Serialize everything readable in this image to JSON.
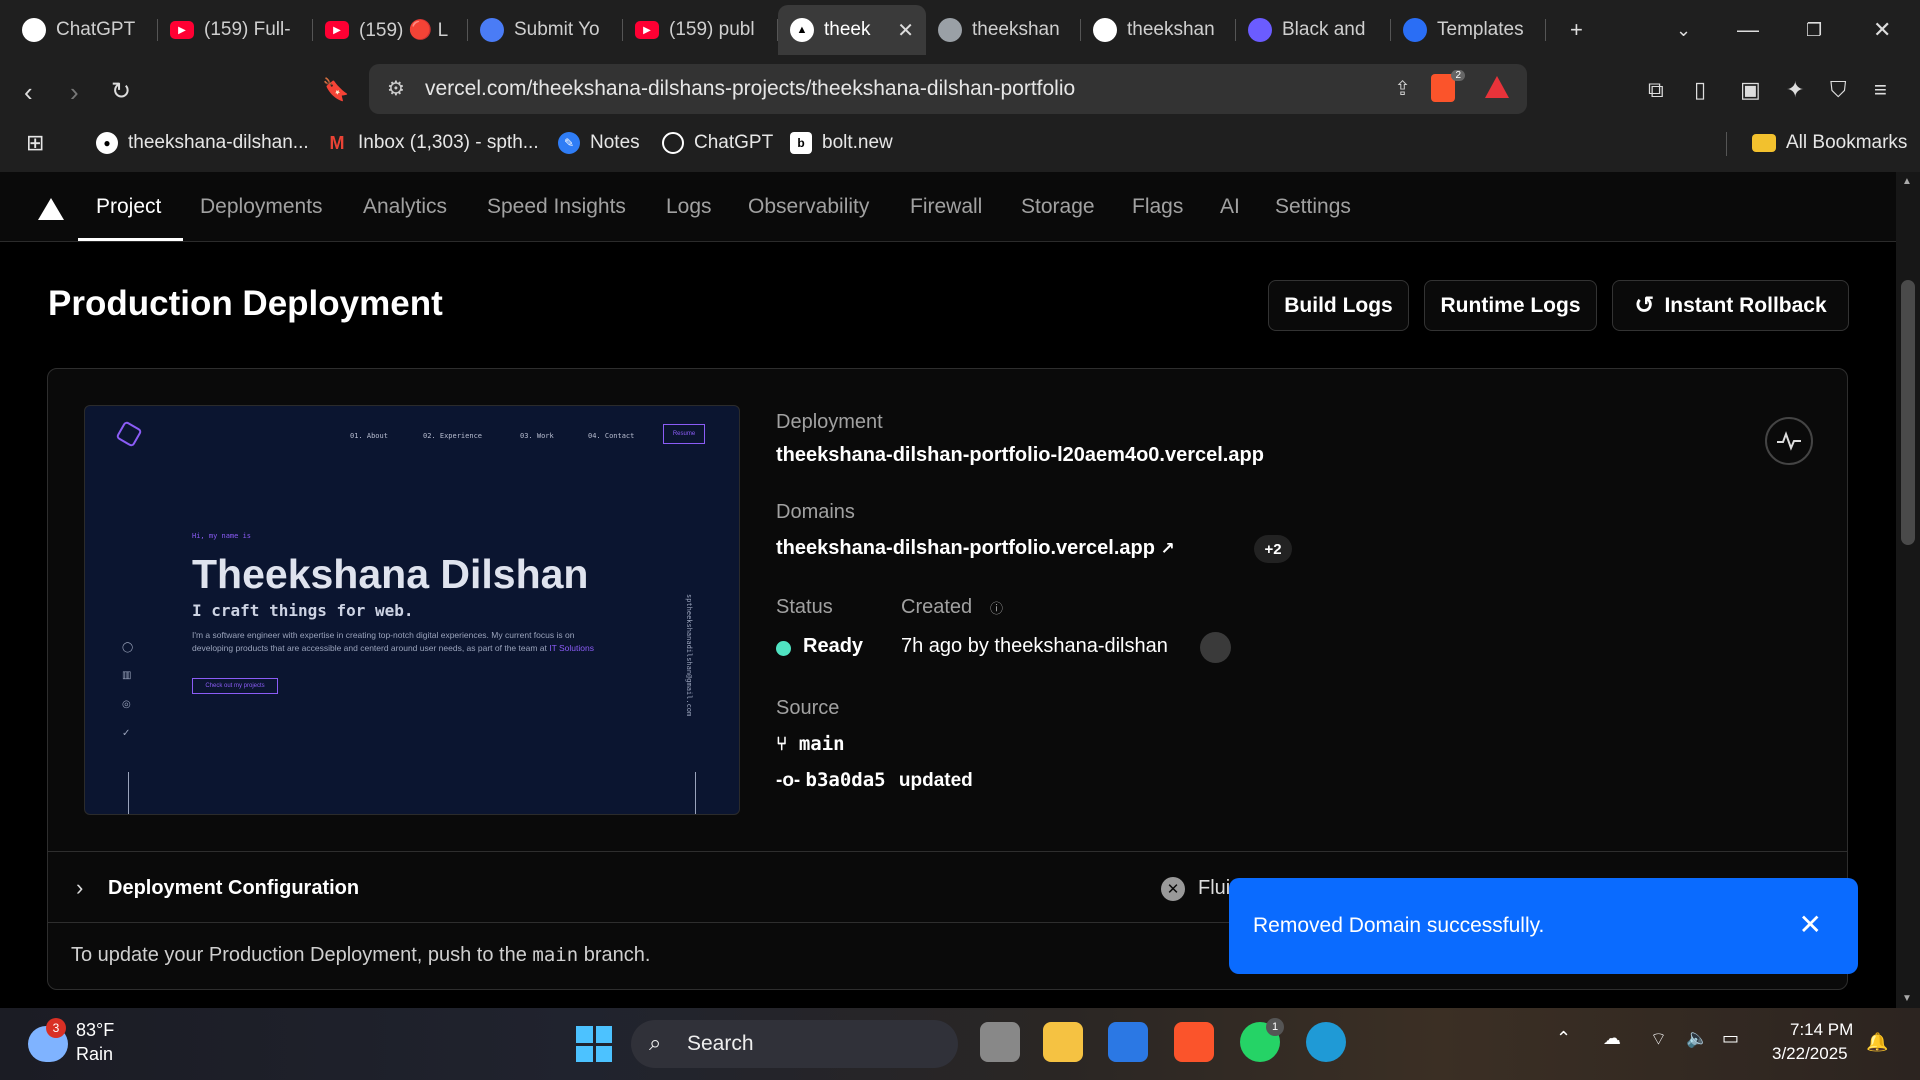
{
  "browser": {
    "tabs": [
      {
        "title": "ChatGPT",
        "icon": "chatgpt-icon",
        "color": "#ffffff"
      },
      {
        "title": "(159) Full-",
        "icon": "youtube-icon",
        "color": "#ff0033"
      },
      {
        "title": "(159) 🔴 L",
        "icon": "youtube-icon",
        "color": "#ff0033"
      },
      {
        "title": "Submit Yo",
        "icon": "form-icon",
        "color": "#4a7cf6"
      },
      {
        "title": "(159) publ",
        "icon": "youtube-icon",
        "color": "#ff0033"
      },
      {
        "title": "theek",
        "icon": "vercel-icon",
        "color": "#ffffff",
        "active": true
      },
      {
        "title": "theekshan",
        "icon": "globe-icon",
        "color": "#9aa0a6"
      },
      {
        "title": "theekshan",
        "icon": "github-icon",
        "color": "#ffffff"
      },
      {
        "title": "Black and",
        "icon": "app-icon",
        "color": "#6b5cff"
      },
      {
        "title": "Templates",
        "icon": "canva-icon",
        "color": "#2a6ef5"
      }
    ],
    "url": "vercel.com/theekshana-dilshans-projects/theekshana-dilshan-portfolio",
    "brave_badge": "2",
    "bookmarks": [
      {
        "label": "theekshana-dilshan...",
        "icon": "github-icon"
      },
      {
        "label": "Inbox (1,303) - spth...",
        "icon": "gmail-icon"
      },
      {
        "label": "Notes",
        "icon": "notes-icon"
      },
      {
        "label": "ChatGPT",
        "icon": "chatgpt-icon"
      },
      {
        "label": "bolt.new",
        "icon": "bolt-icon"
      }
    ],
    "all_bookmarks": "All Bookmarks"
  },
  "nav": {
    "tabs": [
      "Project",
      "Deployments",
      "Analytics",
      "Speed Insights",
      "Logs",
      "Observability",
      "Firewall",
      "Storage",
      "Flags",
      "AI",
      "Settings"
    ],
    "active": "Project"
  },
  "page": {
    "title": "Production Deployment",
    "build_logs": "Build Logs",
    "runtime_logs": "Runtime Logs",
    "instant_rollback": "Instant Rollback"
  },
  "preview": {
    "nav_items": [
      "01. About",
      "02. Experience",
      "03. Work",
      "04. Contact"
    ],
    "resume": "Resume",
    "hi": "Hi, my name is",
    "name": "Theekshana Dilshan",
    "tagline": "I craft things for web.",
    "para": "I'm a software engineer with expertise in creating top-notch digital experiences. My current focus is on developing products that are accessible and centerd around user needs, as part of the team at",
    "company": "IT Solutions",
    "cta": "Check out my projects",
    "email": "sptheekshanadilshan@gmail.com"
  },
  "deployment": {
    "deployment_label": "Deployment",
    "deployment_url": "theekshana-dilshan-portfolio-l20aem4o0.vercel.app",
    "domains_label": "Domains",
    "domain": "theekshana-dilshan-portfolio.vercel.app",
    "domains_more": "+2",
    "status_label": "Status",
    "status": "Ready",
    "created_label": "Created",
    "created": "7h ago by theekshana-dilshan",
    "source_label": "Source",
    "branch": "main",
    "commit": "b3a0da5",
    "commit_msg": "updated"
  },
  "config": {
    "label": "Deployment Configuration",
    "fluid": "Flui",
    "footer_prefix": "To update your Production Deployment, push to the ",
    "footer_branch": "main",
    "footer_suffix": " branch."
  },
  "toast": {
    "message": "Removed Domain successfully."
  },
  "taskbar": {
    "weather_temp": "83°F",
    "weather_cond": "Rain",
    "weather_badge": "3",
    "search": "Search",
    "whatsapp_badge": "1",
    "time": "7:14 PM",
    "date": "3/22/2025"
  }
}
